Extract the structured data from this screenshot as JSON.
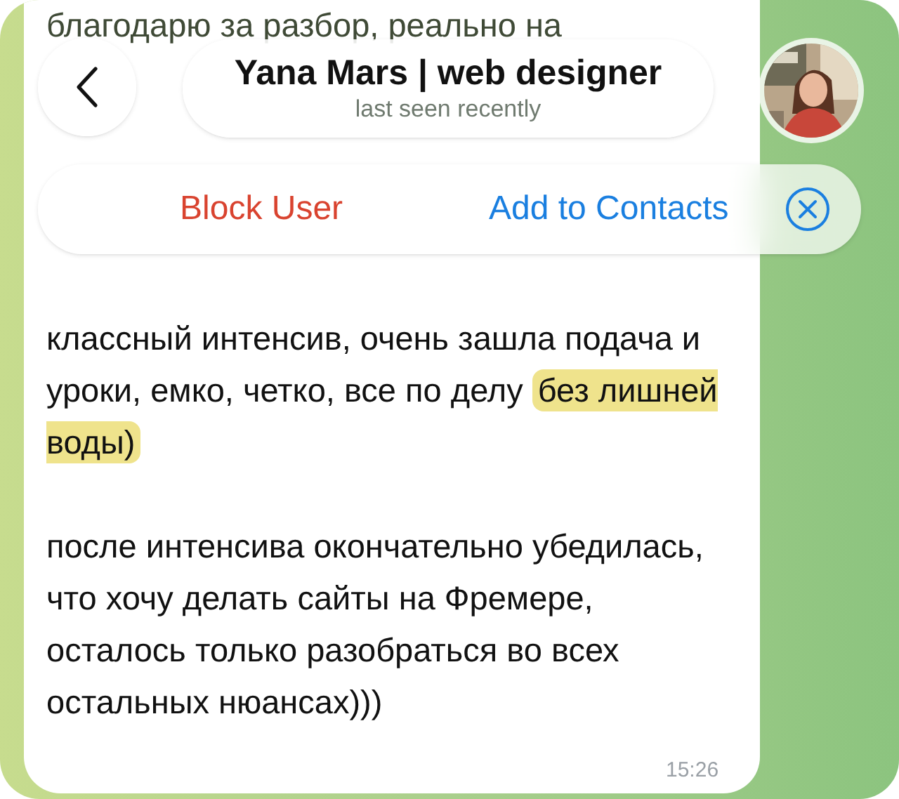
{
  "header": {
    "title": "Yana Mars | web designer",
    "subtitle": "last seen recently"
  },
  "actions": [
    {
      "kind": "danger",
      "label": "Block User"
    },
    {
      "kind": "primary",
      "label": "Add to Contacts"
    }
  ],
  "message": {
    "top_line": "благодарю за разбор, реально на",
    "paragraphs": [
      {
        "text": "классный интенсив, очень зашла подача и уроки, емко, четко, все по делу",
        "highlight": "без лишней воды)"
      },
      {
        "text": "после интенсива окончательно убедилась, что хочу делать сайты на Фремере, осталось только разобраться во всех остальных нюансах)))"
      }
    ],
    "time": "15:26"
  }
}
